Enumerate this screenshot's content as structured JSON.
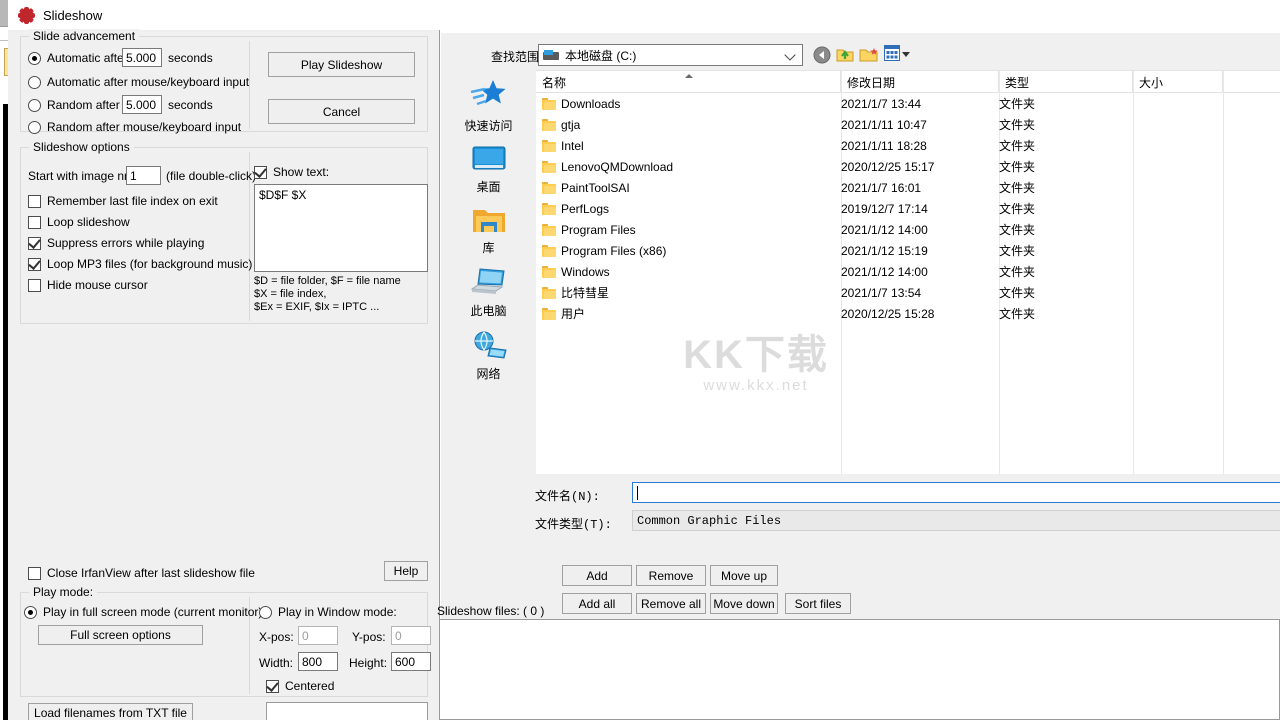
{
  "window": {
    "title": "Slideshow",
    "icon": "irfanview-icon"
  },
  "slide_advancement": {
    "group_label": "Slide advancement",
    "options": [
      {
        "label": "Automatic after",
        "selected": true,
        "value": "5.000",
        "unit": "seconds",
        "has_value": true
      },
      {
        "label": "Automatic after mouse/keyboard input",
        "selected": false,
        "has_value": false
      },
      {
        "label": "Random   after",
        "selected": false,
        "value": "5.000",
        "unit": "seconds",
        "has_value": true
      },
      {
        "label": "Random   after mouse/keyboard input",
        "selected": false,
        "has_value": false
      }
    ],
    "play_button": "Play Slideshow",
    "cancel_button": "Cancel"
  },
  "slideshow_options": {
    "group_label": "Slideshow options",
    "start_label": "Start with image nr.:",
    "start_value": "1",
    "start_hint": "(file double-click)",
    "checkboxes": [
      {
        "label": "Remember last file index on exit",
        "checked": false
      },
      {
        "label": "Loop slideshow",
        "checked": false
      },
      {
        "label": "Suppress errors while playing",
        "checked": true
      },
      {
        "label": "Loop MP3 files (for background music)",
        "checked": true
      },
      {
        "label": "Hide mouse cursor",
        "checked": false
      }
    ],
    "show_text": {
      "label": "Show text:",
      "checked": true
    },
    "text_value": "$D$F $X",
    "legend": "$D = file folder, $F = file name\n$X = file index,\n$Ex = EXIF, $Ix = IPTC ..."
  },
  "bottom_left": {
    "close_after_label": "Close IrfanView after last slideshow file",
    "close_after_checked": false,
    "help_button": "Help",
    "play_mode_group": "Play mode:",
    "fullscreen_option": {
      "label": "Play in full screen mode (current monitor)",
      "selected": true
    },
    "fullscreen_button": "Full screen options",
    "window_option": {
      "label": "Play in Window mode:",
      "selected": false
    },
    "xpos_label": "X-pos:",
    "xpos_value": "0",
    "ypos_label": "Y-pos:",
    "ypos_value": "0",
    "width_label": "Width:",
    "width_value": "800",
    "height_label": "Height:",
    "height_value": "600",
    "centered_label": "Centered",
    "centered_checked": true,
    "load_txt_button": "Load filenames from TXT file"
  },
  "file_dialog": {
    "lookin_label": "查找范围(I):",
    "lookin_value": "本地磁盘 (C:)",
    "toolbar": [
      "back-icon",
      "up-folder-icon",
      "new-folder-icon",
      "views-icon"
    ],
    "places": [
      {
        "label": "快速访问",
        "icon": "quick-access-star-icon"
      },
      {
        "label": "桌面",
        "icon": "desktop-monitor-icon"
      },
      {
        "label": "库",
        "icon": "library-folder-icon"
      },
      {
        "label": "此电脑",
        "icon": "this-pc-icon"
      },
      {
        "label": "网络",
        "icon": "network-globe-icon"
      }
    ],
    "columns": [
      "名称",
      "修改日期",
      "类型",
      "大小"
    ],
    "rows": [
      {
        "name": "Downloads",
        "date": "2021/1/7 13:44",
        "type": "文件夹",
        "size": ""
      },
      {
        "name": "gtja",
        "date": "2021/1/11 10:47",
        "type": "文件夹",
        "size": ""
      },
      {
        "name": "Intel",
        "date": "2021/1/11 18:28",
        "type": "文件夹",
        "size": ""
      },
      {
        "name": "LenovoQMDownload",
        "date": "2020/12/25 15:17",
        "type": "文件夹",
        "size": ""
      },
      {
        "name": "PaintToolSAI",
        "date": "2021/1/7 16:01",
        "type": "文件夹",
        "size": ""
      },
      {
        "name": "PerfLogs",
        "date": "2019/12/7 17:14",
        "type": "文件夹",
        "size": ""
      },
      {
        "name": "Program Files",
        "date": "2021/1/12 14:00",
        "type": "文件夹",
        "size": ""
      },
      {
        "name": "Program Files (x86)",
        "date": "2021/1/12 15:19",
        "type": "文件夹",
        "size": ""
      },
      {
        "name": "Windows",
        "date": "2021/1/12 14:00",
        "type": "文件夹",
        "size": ""
      },
      {
        "name": "比特彗星",
        "date": "2021/1/7 13:54",
        "type": "文件夹",
        "size": ""
      },
      {
        "name": "用户",
        "date": "2020/12/25 15:28",
        "type": "文件夹",
        "size": ""
      }
    ],
    "watermark_main": "KK下载",
    "watermark_sub": "www.kkx.net",
    "filename_label": "文件名(N):",
    "filename_value": "",
    "filetype_label": "文件类型(T):",
    "filetype_value": "Common Graphic Files"
  },
  "file_actions": {
    "row1": [
      "Add",
      "Remove",
      "Move up"
    ],
    "row2": [
      "Add all",
      "Remove all",
      "Move down",
      "Sort files"
    ],
    "slideshow_files_label": "Slideshow files:  ( 0 )"
  }
}
